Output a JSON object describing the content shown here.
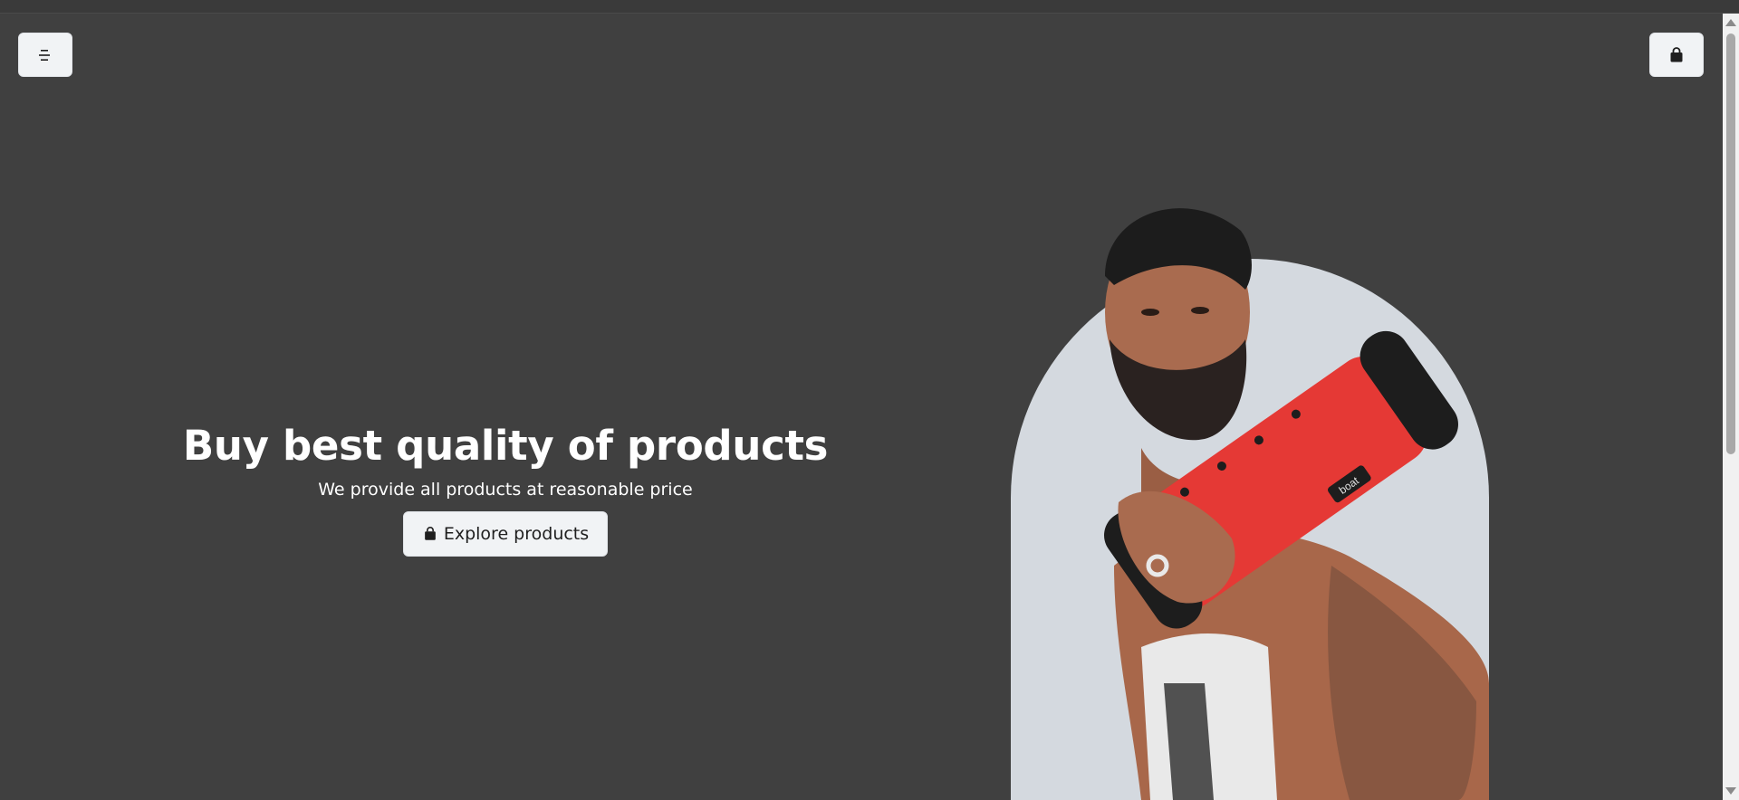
{
  "header": {
    "menu_icon": "menu-icon",
    "cart_icon": "shopping-bag-icon"
  },
  "hero": {
    "title": "Buy best quality of products",
    "subtitle": "We provide all products at reasonable price",
    "cta_label": "Explore products",
    "cta_icon": "shopping-bag-icon",
    "image_brand_text": "boat"
  },
  "colors": {
    "background": "#404040",
    "button_bg": "#f1f3f5",
    "arch_bg": "#d4d9df",
    "speaker_red": "#e53935"
  }
}
